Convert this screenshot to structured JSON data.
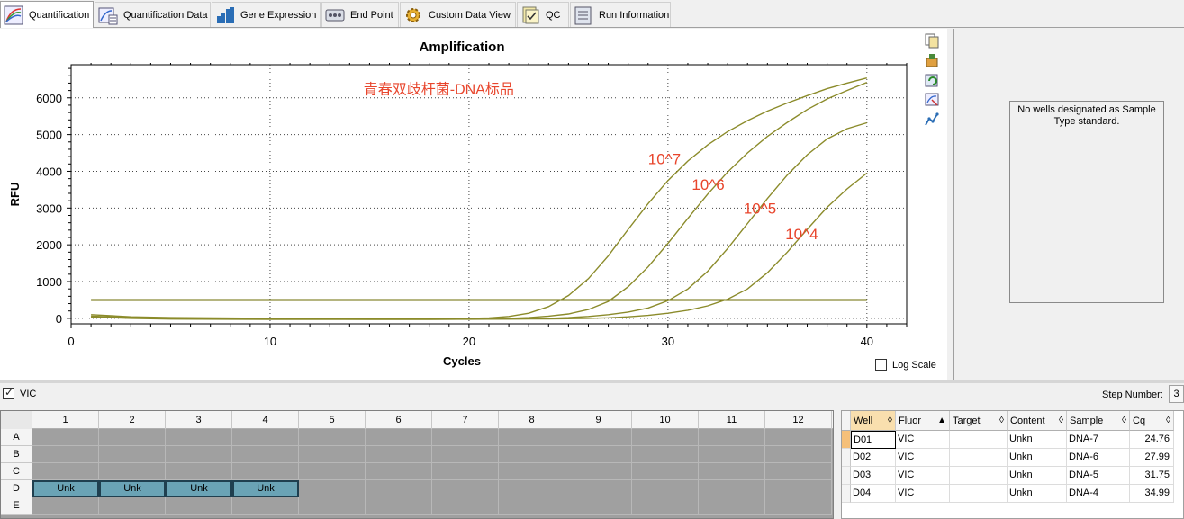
{
  "tabs": [
    {
      "label": "Quantification",
      "icon": "quantification-icon",
      "active": true
    },
    {
      "label": "Quantification Data",
      "icon": "quantification-data-icon"
    },
    {
      "label": "Gene Expression",
      "icon": "gene-expression-icon"
    },
    {
      "label": "End Point",
      "icon": "end-point-icon"
    },
    {
      "label": "Custom Data View",
      "icon": "custom-data-view-icon"
    },
    {
      "label": "QC",
      "icon": "qc-icon"
    },
    {
      "label": "Run Information",
      "icon": "run-information-icon"
    }
  ],
  "chart_data": {
    "type": "line",
    "title": "Amplification",
    "xlabel": "Cycles",
    "ylabel": "RFU",
    "xlim": [
      0,
      42
    ],
    "ylim": [
      -150,
      6900
    ],
    "xticks": [
      0,
      10,
      20,
      30,
      40
    ],
    "yticks": [
      0,
      1000,
      2000,
      3000,
      4000,
      5000,
      6000
    ],
    "grid": true,
    "threshold": 500,
    "watermark": "青春双歧杆菌-DNA标品",
    "colors": {
      "curve": "#8b8b2a",
      "threshold": "#6b6b00",
      "annotation": "#e8452c"
    },
    "x": [
      1,
      3,
      5,
      10,
      15,
      18,
      20,
      21,
      22,
      23,
      24,
      25,
      26,
      27,
      28,
      29,
      30,
      31,
      32,
      33,
      34,
      35,
      36,
      37,
      38,
      39,
      40
    ],
    "series": [
      {
        "name": "10^7",
        "label_at": [
          29.0,
          4200
        ],
        "values": [
          100,
          40,
          20,
          0,
          -10,
          -10,
          0,
          10,
          50,
          140,
          320,
          620,
          1080,
          1700,
          2420,
          3120,
          3750,
          4280,
          4720,
          5080,
          5380,
          5640,
          5860,
          6060,
          6250,
          6400,
          6540
        ]
      },
      {
        "name": "10^6",
        "label_at": [
          31.2,
          3500
        ],
        "values": [
          60,
          20,
          0,
          -20,
          -20,
          -20,
          -15,
          -10,
          0,
          20,
          60,
          120,
          240,
          460,
          860,
          1400,
          2040,
          2720,
          3380,
          3980,
          4500,
          4950,
          5330,
          5680,
          5970,
          6200,
          6420
        ]
      },
      {
        "name": "10^5",
        "label_at": [
          33.8,
          2850
        ],
        "values": [
          40,
          10,
          -10,
          -20,
          -25,
          -25,
          -20,
          -18,
          -15,
          -10,
          0,
          20,
          50,
          100,
          170,
          280,
          480,
          800,
          1280,
          1900,
          2580,
          3260,
          3900,
          4450,
          4880,
          5160,
          5320
        ]
      },
      {
        "name": "10^4",
        "label_at": [
          35.9,
          2150
        ],
        "values": [
          30,
          0,
          -20,
          -30,
          -30,
          -30,
          -25,
          -22,
          -20,
          -18,
          -15,
          -10,
          0,
          15,
          40,
          80,
          140,
          220,
          340,
          520,
          800,
          1240,
          1800,
          2420,
          3020,
          3520,
          3950
        ]
      }
    ]
  },
  "chart_tools": [
    {
      "icon": "copy-icon"
    },
    {
      "icon": "export-icon"
    },
    {
      "icon": "refresh-icon"
    },
    {
      "icon": "zoom-icon"
    },
    {
      "icon": "trend-icon"
    }
  ],
  "log_scale": {
    "label": "Log Scale",
    "checked": false
  },
  "standards_panel": {
    "message": "No wells designated as Sample Type standard."
  },
  "fluor": {
    "label": "VIC",
    "checked": true
  },
  "step": {
    "label": "Step Number:",
    "value": "3"
  },
  "plate": {
    "columns": [
      "1",
      "2",
      "3",
      "4",
      "5",
      "6",
      "7",
      "8",
      "9",
      "10",
      "11",
      "12"
    ],
    "rows": [
      "A",
      "B",
      "C",
      "D",
      "E"
    ],
    "filled": [
      {
        "row": "D",
        "col": "1",
        "label": "Unk"
      },
      {
        "row": "D",
        "col": "2",
        "label": "Unk"
      },
      {
        "row": "D",
        "col": "3",
        "label": "Unk"
      },
      {
        "row": "D",
        "col": "4",
        "label": "Unk"
      }
    ]
  },
  "table": {
    "headers": [
      {
        "label": "Well",
        "sort": "◊"
      },
      {
        "label": "Fluor",
        "sort": "▲"
      },
      {
        "label": "Target",
        "sort": "◊"
      },
      {
        "label": "Content",
        "sort": "◊"
      },
      {
        "label": "Sample",
        "sort": "◊"
      },
      {
        "label": "Cq",
        "sort": "◊"
      }
    ],
    "rows": [
      [
        "D01",
        "VIC",
        "",
        "Unkn",
        "DNA-7",
        "24.76"
      ],
      [
        "D02",
        "VIC",
        "",
        "Unkn",
        "DNA-6",
        "27.99"
      ],
      [
        "D03",
        "VIC",
        "",
        "Unkn",
        "DNA-5",
        "31.75"
      ],
      [
        "D04",
        "VIC",
        "",
        "Unkn",
        "DNA-4",
        "34.99"
      ]
    ]
  }
}
